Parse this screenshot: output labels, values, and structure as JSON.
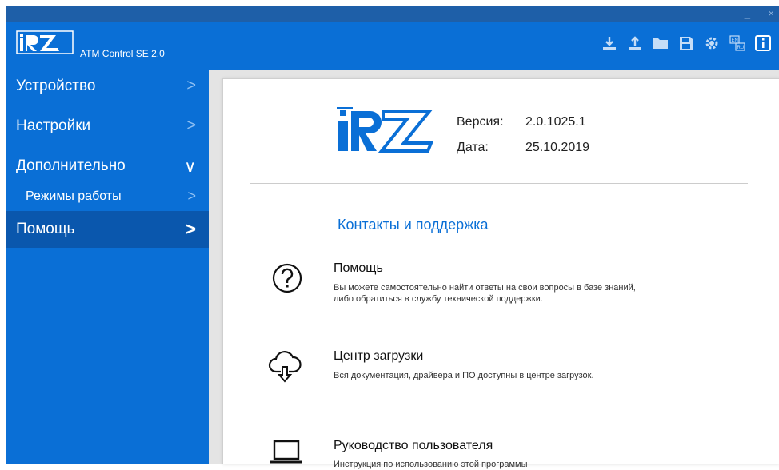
{
  "window": {
    "minimize": "_",
    "close": "×"
  },
  "header": {
    "logo_text": "iRZ",
    "app_title": "ATM Control SE 2.0",
    "toolbar": [
      {
        "name": "download-icon"
      },
      {
        "name": "upload-icon"
      },
      {
        "name": "folder-icon"
      },
      {
        "name": "save-icon"
      },
      {
        "name": "settings-gear-icon"
      },
      {
        "name": "language-en-ru-icon"
      },
      {
        "name": "info-icon"
      }
    ]
  },
  "sidebar": {
    "items": [
      {
        "label": "Устройство",
        "arrow": ">"
      },
      {
        "label": "Настройки",
        "arrow": ">"
      },
      {
        "label": "Дополнительно",
        "arrow": "∨"
      },
      {
        "label": "Режимы работы",
        "arrow": ">"
      },
      {
        "label": "Помощь",
        "arrow": ">"
      }
    ]
  },
  "about": {
    "logo_text": "iRZ",
    "version_label": "Версия:",
    "version_value": "2.0.1025.1",
    "date_label": "Дата:",
    "date_value": "25.10.2019"
  },
  "contacts": {
    "title": "Контакты и поддержка",
    "items": [
      {
        "icon": "help-question-icon",
        "title": "Помощь",
        "desc_line1": "Вы можете самостоятельно найти ответы на свои вопросы в базе знаний,",
        "desc_line2": "либо обратиться в службу технической поддержки."
      },
      {
        "icon": "cloud-download-icon",
        "title": "Центр загрузки",
        "desc_line1": "Вся документация, драйвера и ПО доступны в центре загрузок."
      },
      {
        "icon": "laptop-icon",
        "title": "Руководство пользователя",
        "desc_line1": "Инструкция по использованию этой программы"
      }
    ]
  },
  "colors": {
    "accent": "#0a6fd6",
    "sidebar_active": "#0a57ad",
    "titlebar": "#1e5fa8"
  }
}
